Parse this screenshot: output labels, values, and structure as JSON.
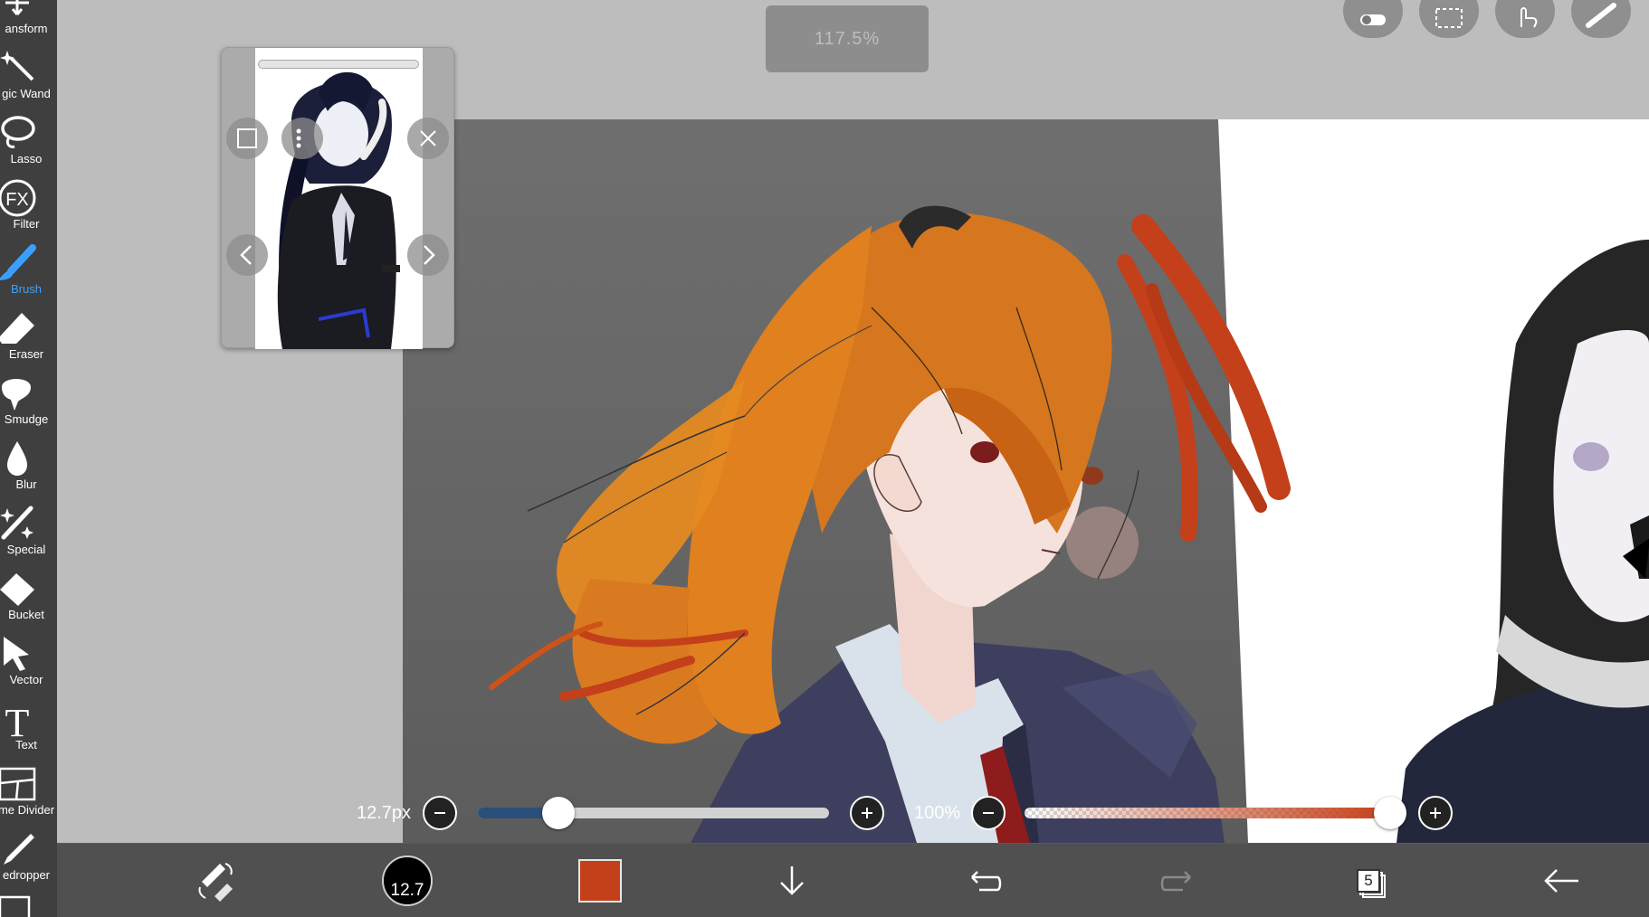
{
  "zoom": {
    "label": "117.5%"
  },
  "tools": [
    {
      "id": "transform",
      "label": "ansform"
    },
    {
      "id": "magic-wand",
      "label": "gic Wand"
    },
    {
      "id": "lasso",
      "label": "Lasso"
    },
    {
      "id": "filter",
      "label": "Filter",
      "icon_text": "FX"
    },
    {
      "id": "brush",
      "label": "Brush",
      "active": true
    },
    {
      "id": "eraser",
      "label": "Eraser"
    },
    {
      "id": "smudge",
      "label": "Smudge"
    },
    {
      "id": "blur",
      "label": "Blur"
    },
    {
      "id": "special",
      "label": "Special"
    },
    {
      "id": "bucket",
      "label": "Bucket"
    },
    {
      "id": "vector",
      "label": "Vector"
    },
    {
      "id": "text",
      "label": "Text",
      "icon_text": "T"
    },
    {
      "id": "frame-divider",
      "label": "me Divider"
    },
    {
      "id": "eyedropper",
      "label": "edropper"
    }
  ],
  "slider_bar": {
    "brush_size_label": "12.7px",
    "brush_size_fraction": 0.23,
    "opacity_label": "100%",
    "opacity_fraction": 1.0,
    "minus": "−",
    "plus": "+"
  },
  "bottom_bar": {
    "brush_size_value": "12.7",
    "current_color": "#c4401a",
    "layer_count": "5"
  },
  "colors": {
    "toolbar_bg": "#3f3f3f",
    "active_tool": "#3aa0ff",
    "canvas_bg": "#bdbdbd",
    "brush_color": "#c4401a",
    "size_fill": "#2a4f7a"
  }
}
